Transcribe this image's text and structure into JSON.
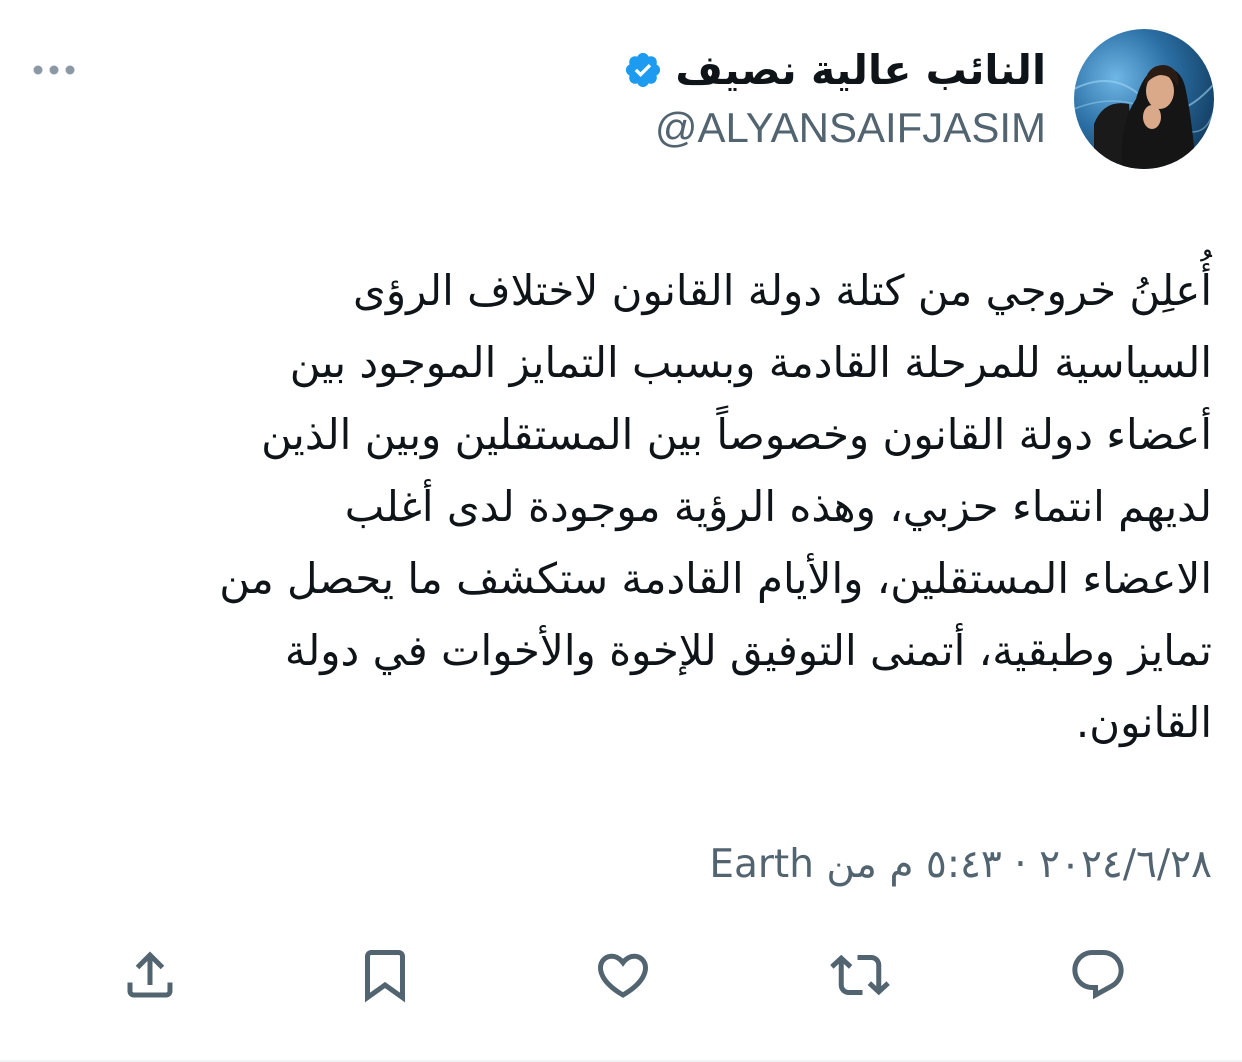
{
  "author": {
    "display_name": "النائب عالية نصيف",
    "handle": "@ALYANSAIFJASIM",
    "verified": true,
    "avatar_icon": "profile-photo-avatar"
  },
  "tweet": {
    "lines": [
      "أُعلِنُ خروجي من كتلة دولة القانون لاختلاف الرؤى",
      "السياسية للمرحلة القادمة وبسبب التمايز الموجود بين",
      "أعضاء دولة القانون وخصوصاً بين المستقلين وبين الذين",
      "لديهم انتماء حزبي، وهذه الرؤية موجودة لدى أغلب",
      "الاعضاء المستقلين، والأيام القادمة ستكشف ما يحصل من",
      "تمايز وطبقية، أتمنى التوفيق للإخوة والأخوات في دولة",
      "القانون."
    ]
  },
  "meta": {
    "date": "٢٠٢٤/٦/٢٨",
    "separator": "·",
    "time": "٥:٤٣ م",
    "source_prefix": "من",
    "source": "Earth"
  },
  "actions": [
    {
      "name": "reply",
      "icon": "reply-icon"
    },
    {
      "name": "retweet",
      "icon": "retweet-icon"
    },
    {
      "name": "like",
      "icon": "heart-icon"
    },
    {
      "name": "bookmark",
      "icon": "bookmark-icon"
    },
    {
      "name": "share",
      "icon": "share-icon"
    }
  ],
  "colors": {
    "text": "#0f1419",
    "secondary": "#536471",
    "verified": "#1d9bf0",
    "icon": "#536471"
  }
}
